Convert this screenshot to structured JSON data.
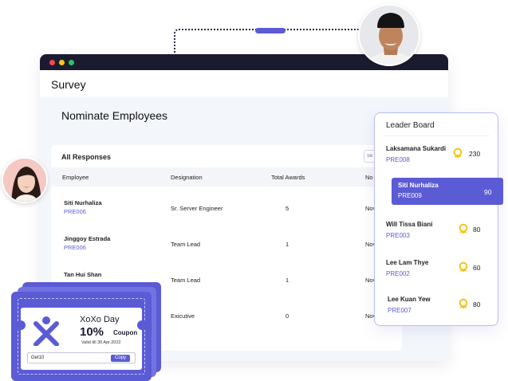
{
  "window": {
    "title": "Survey",
    "section_title": "Nominate Employees"
  },
  "responses": {
    "title": "All Responses",
    "search_placeholder": "Se",
    "columns": [
      "Employee",
      "Designation",
      "Total Awards",
      "No"
    ],
    "rows": [
      {
        "name": "Siti Nurhaliza",
        "id": "PRE006",
        "designation": "Sr. Server Engineer",
        "awards": "5",
        "extra": "Nov"
      },
      {
        "name": "Jinggoy Estrada",
        "id": "PRE006",
        "designation": "Team Lead",
        "awards": "1",
        "extra": "Nov"
      },
      {
        "name": "Tan Hui Shan",
        "id": "",
        "designation": "Team Lead",
        "awards": "1",
        "extra": "Nov"
      },
      {
        "name": "",
        "id": "",
        "designation": "Exicutive",
        "awards": "0",
        "extra": "Nov"
      }
    ]
  },
  "leaderboard": {
    "title": "Leader Board",
    "items": [
      {
        "name": "Laksamana Sukardi",
        "id": "PRE008",
        "score": "230"
      },
      {
        "name": "Siti Nurhaliza",
        "id": "PRE009",
        "score": "90",
        "highlighted": true
      },
      {
        "name": "Will Tissa Biani",
        "id": "PRE003",
        "score": "80"
      },
      {
        "name": "Lee Lam Thye",
        "id": "PRE002",
        "score": "60"
      },
      {
        "name": "Lee Kuan Yew",
        "id": "PRE007",
        "score": "80"
      }
    ]
  },
  "coupon": {
    "brand": "XoXo Day",
    "percent": "10%",
    "word": "Coupon",
    "valid": "Valid till 30 Apr.2022",
    "code": "Get10",
    "copy_label": "Copy"
  },
  "colors": {
    "accent": "#5b5bd6",
    "titlebar": "#1b1b30",
    "medal": "#f5c518"
  }
}
